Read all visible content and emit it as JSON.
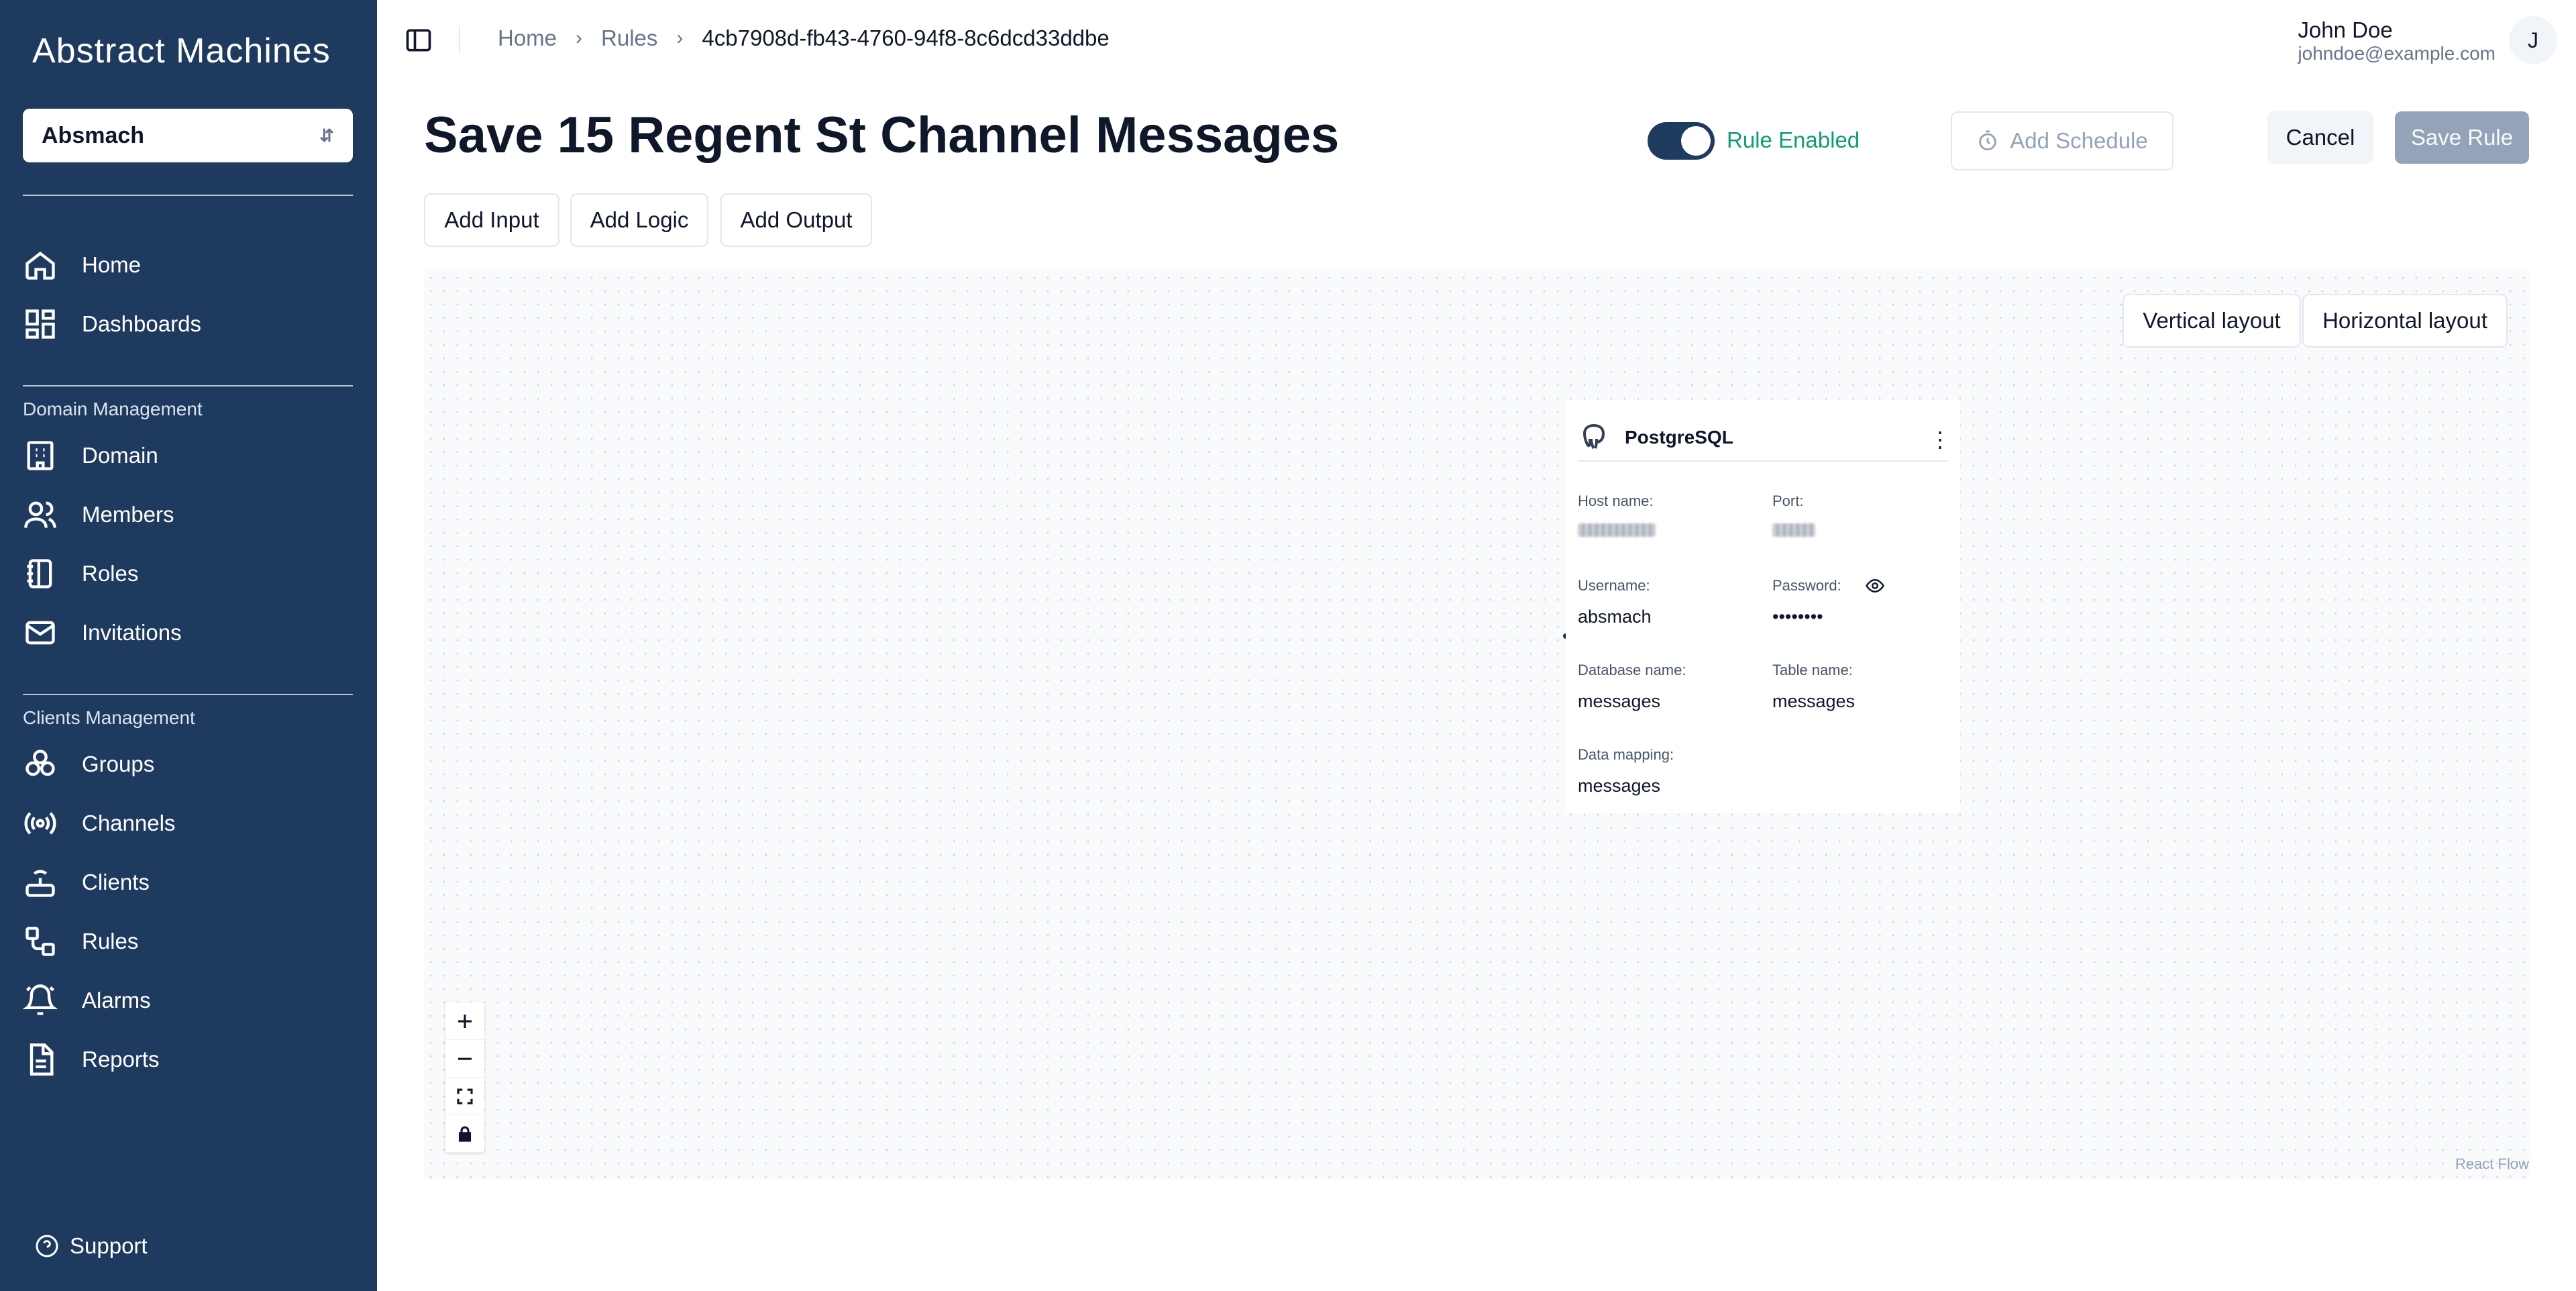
{
  "app": {
    "logo": "Abstract Machines",
    "workspace": "Absmach"
  },
  "sidebar": {
    "main_items": [
      {
        "label": "Home",
        "icon": "home-icon"
      },
      {
        "label": "Dashboards",
        "icon": "dashboard-icon"
      }
    ],
    "domain_section_title": "Domain Management",
    "domain_items": [
      {
        "label": "Domain",
        "icon": "building-icon"
      },
      {
        "label": "Members",
        "icon": "users-icon"
      },
      {
        "label": "Roles",
        "icon": "notebook-icon"
      },
      {
        "label": "Invitations",
        "icon": "mail-icon"
      }
    ],
    "clients_section_title": "Clients Management",
    "clients_items": [
      {
        "label": "Groups",
        "icon": "groups-icon"
      },
      {
        "label": "Channels",
        "icon": "radio-icon"
      },
      {
        "label": "Clients",
        "icon": "router-icon"
      },
      {
        "label": "Rules",
        "icon": "workflow-icon"
      },
      {
        "label": "Alarms",
        "icon": "bell-icon"
      },
      {
        "label": "Reports",
        "icon": "report-icon"
      }
    ],
    "support_label": "Support"
  },
  "topbar": {
    "breadcrumb": [
      "Home",
      "Rules",
      "4cb7908d-fb43-4760-94f8-8c6dcd33ddbe"
    ],
    "user_name": "John Doe",
    "user_email": "johndoe@example.com",
    "avatar_initial": "J"
  },
  "header": {
    "title": "Save 15 Regent St Channel Messages",
    "rule_enabled_label": "Rule Enabled",
    "rule_enabled": true,
    "add_schedule_label": "Add Schedule",
    "cancel_label": "Cancel",
    "save_label": "Save Rule"
  },
  "toolbar": {
    "add_input": "Add Input",
    "add_logic": "Add Logic",
    "add_output": "Add Output"
  },
  "canvas": {
    "vertical_layout": "Vertical layout",
    "horizontal_layout": "Horizontal layout",
    "attribution": "React Flow",
    "node": {
      "title": "PostgreSQL",
      "host_label": "Host name:",
      "port_label": "Port:",
      "username_label": "Username:",
      "username": "absmach",
      "password_label": "Password:",
      "password": "••••••••",
      "database_label": "Database name:",
      "database": "messages",
      "table_label": "Table name:",
      "table": "messages",
      "mapping_label": "Data mapping:",
      "mapping": "messages"
    }
  },
  "colors": {
    "sidebar": "#1f3a5f",
    "accent_green": "#0f9d73",
    "save_disabled": "#94a3b8"
  }
}
